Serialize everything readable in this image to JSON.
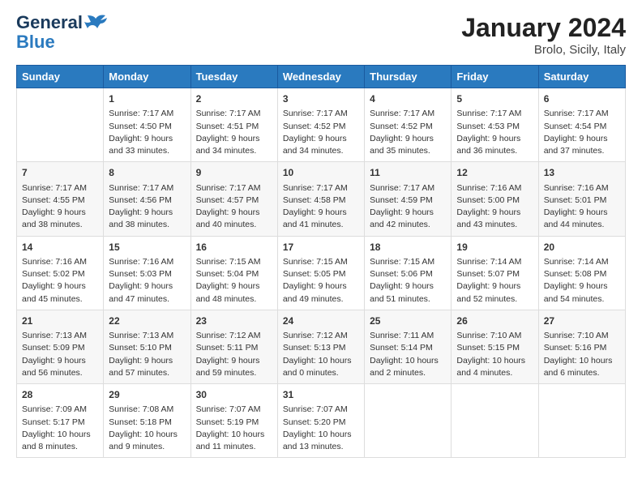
{
  "logo": {
    "line1": "General",
    "line2": "Blue"
  },
  "title": "January 2024",
  "subtitle": "Brolo, Sicily, Italy",
  "header_days": [
    "Sunday",
    "Monday",
    "Tuesday",
    "Wednesday",
    "Thursday",
    "Friday",
    "Saturday"
  ],
  "weeks": [
    [
      {
        "num": "",
        "lines": []
      },
      {
        "num": "1",
        "lines": [
          "Sunrise: 7:17 AM",
          "Sunset: 4:50 PM",
          "Daylight: 9 hours",
          "and 33 minutes."
        ]
      },
      {
        "num": "2",
        "lines": [
          "Sunrise: 7:17 AM",
          "Sunset: 4:51 PM",
          "Daylight: 9 hours",
          "and 34 minutes."
        ]
      },
      {
        "num": "3",
        "lines": [
          "Sunrise: 7:17 AM",
          "Sunset: 4:52 PM",
          "Daylight: 9 hours",
          "and 34 minutes."
        ]
      },
      {
        "num": "4",
        "lines": [
          "Sunrise: 7:17 AM",
          "Sunset: 4:52 PM",
          "Daylight: 9 hours",
          "and 35 minutes."
        ]
      },
      {
        "num": "5",
        "lines": [
          "Sunrise: 7:17 AM",
          "Sunset: 4:53 PM",
          "Daylight: 9 hours",
          "and 36 minutes."
        ]
      },
      {
        "num": "6",
        "lines": [
          "Sunrise: 7:17 AM",
          "Sunset: 4:54 PM",
          "Daylight: 9 hours",
          "and 37 minutes."
        ]
      }
    ],
    [
      {
        "num": "7",
        "lines": [
          "Sunrise: 7:17 AM",
          "Sunset: 4:55 PM",
          "Daylight: 9 hours",
          "and 38 minutes."
        ]
      },
      {
        "num": "8",
        "lines": [
          "Sunrise: 7:17 AM",
          "Sunset: 4:56 PM",
          "Daylight: 9 hours",
          "and 38 minutes."
        ]
      },
      {
        "num": "9",
        "lines": [
          "Sunrise: 7:17 AM",
          "Sunset: 4:57 PM",
          "Daylight: 9 hours",
          "and 40 minutes."
        ]
      },
      {
        "num": "10",
        "lines": [
          "Sunrise: 7:17 AM",
          "Sunset: 4:58 PM",
          "Daylight: 9 hours",
          "and 41 minutes."
        ]
      },
      {
        "num": "11",
        "lines": [
          "Sunrise: 7:17 AM",
          "Sunset: 4:59 PM",
          "Daylight: 9 hours",
          "and 42 minutes."
        ]
      },
      {
        "num": "12",
        "lines": [
          "Sunrise: 7:16 AM",
          "Sunset: 5:00 PM",
          "Daylight: 9 hours",
          "and 43 minutes."
        ]
      },
      {
        "num": "13",
        "lines": [
          "Sunrise: 7:16 AM",
          "Sunset: 5:01 PM",
          "Daylight: 9 hours",
          "and 44 minutes."
        ]
      }
    ],
    [
      {
        "num": "14",
        "lines": [
          "Sunrise: 7:16 AM",
          "Sunset: 5:02 PM",
          "Daylight: 9 hours",
          "and 45 minutes."
        ]
      },
      {
        "num": "15",
        "lines": [
          "Sunrise: 7:16 AM",
          "Sunset: 5:03 PM",
          "Daylight: 9 hours",
          "and 47 minutes."
        ]
      },
      {
        "num": "16",
        "lines": [
          "Sunrise: 7:15 AM",
          "Sunset: 5:04 PM",
          "Daylight: 9 hours",
          "and 48 minutes."
        ]
      },
      {
        "num": "17",
        "lines": [
          "Sunrise: 7:15 AM",
          "Sunset: 5:05 PM",
          "Daylight: 9 hours",
          "and 49 minutes."
        ]
      },
      {
        "num": "18",
        "lines": [
          "Sunrise: 7:15 AM",
          "Sunset: 5:06 PM",
          "Daylight: 9 hours",
          "and 51 minutes."
        ]
      },
      {
        "num": "19",
        "lines": [
          "Sunrise: 7:14 AM",
          "Sunset: 5:07 PM",
          "Daylight: 9 hours",
          "and 52 minutes."
        ]
      },
      {
        "num": "20",
        "lines": [
          "Sunrise: 7:14 AM",
          "Sunset: 5:08 PM",
          "Daylight: 9 hours",
          "and 54 minutes."
        ]
      }
    ],
    [
      {
        "num": "21",
        "lines": [
          "Sunrise: 7:13 AM",
          "Sunset: 5:09 PM",
          "Daylight: 9 hours",
          "and 56 minutes."
        ]
      },
      {
        "num": "22",
        "lines": [
          "Sunrise: 7:13 AM",
          "Sunset: 5:10 PM",
          "Daylight: 9 hours",
          "and 57 minutes."
        ]
      },
      {
        "num": "23",
        "lines": [
          "Sunrise: 7:12 AM",
          "Sunset: 5:11 PM",
          "Daylight: 9 hours",
          "and 59 minutes."
        ]
      },
      {
        "num": "24",
        "lines": [
          "Sunrise: 7:12 AM",
          "Sunset: 5:13 PM",
          "Daylight: 10 hours",
          "and 0 minutes."
        ]
      },
      {
        "num": "25",
        "lines": [
          "Sunrise: 7:11 AM",
          "Sunset: 5:14 PM",
          "Daylight: 10 hours",
          "and 2 minutes."
        ]
      },
      {
        "num": "26",
        "lines": [
          "Sunrise: 7:10 AM",
          "Sunset: 5:15 PM",
          "Daylight: 10 hours",
          "and 4 minutes."
        ]
      },
      {
        "num": "27",
        "lines": [
          "Sunrise: 7:10 AM",
          "Sunset: 5:16 PM",
          "Daylight: 10 hours",
          "and 6 minutes."
        ]
      }
    ],
    [
      {
        "num": "28",
        "lines": [
          "Sunrise: 7:09 AM",
          "Sunset: 5:17 PM",
          "Daylight: 10 hours",
          "and 8 minutes."
        ]
      },
      {
        "num": "29",
        "lines": [
          "Sunrise: 7:08 AM",
          "Sunset: 5:18 PM",
          "Daylight: 10 hours",
          "and 9 minutes."
        ]
      },
      {
        "num": "30",
        "lines": [
          "Sunrise: 7:07 AM",
          "Sunset: 5:19 PM",
          "Daylight: 10 hours",
          "and 11 minutes."
        ]
      },
      {
        "num": "31",
        "lines": [
          "Sunrise: 7:07 AM",
          "Sunset: 5:20 PM",
          "Daylight: 10 hours",
          "and 13 minutes."
        ]
      },
      {
        "num": "",
        "lines": []
      },
      {
        "num": "",
        "lines": []
      },
      {
        "num": "",
        "lines": []
      }
    ]
  ]
}
